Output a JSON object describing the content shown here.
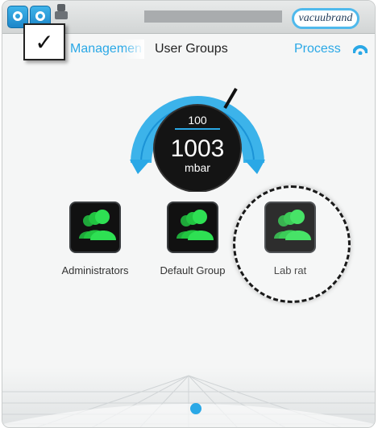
{
  "header": {
    "logo_text": "vacuubrand"
  },
  "nav": {
    "prev_label": "Management",
    "title": "User Groups",
    "process_label": "Process"
  },
  "gauge": {
    "setpoint": "100",
    "value": "1003",
    "unit": "mbar"
  },
  "groups": [
    {
      "label": "Administrators"
    },
    {
      "label": "Default Group"
    },
    {
      "label": "Lab rat"
    }
  ],
  "overlay": {
    "checkmark": "✓"
  },
  "colors": {
    "accent": "#2aa8e6",
    "tile_bg": "#111111",
    "group_icon": "#22cc44"
  }
}
